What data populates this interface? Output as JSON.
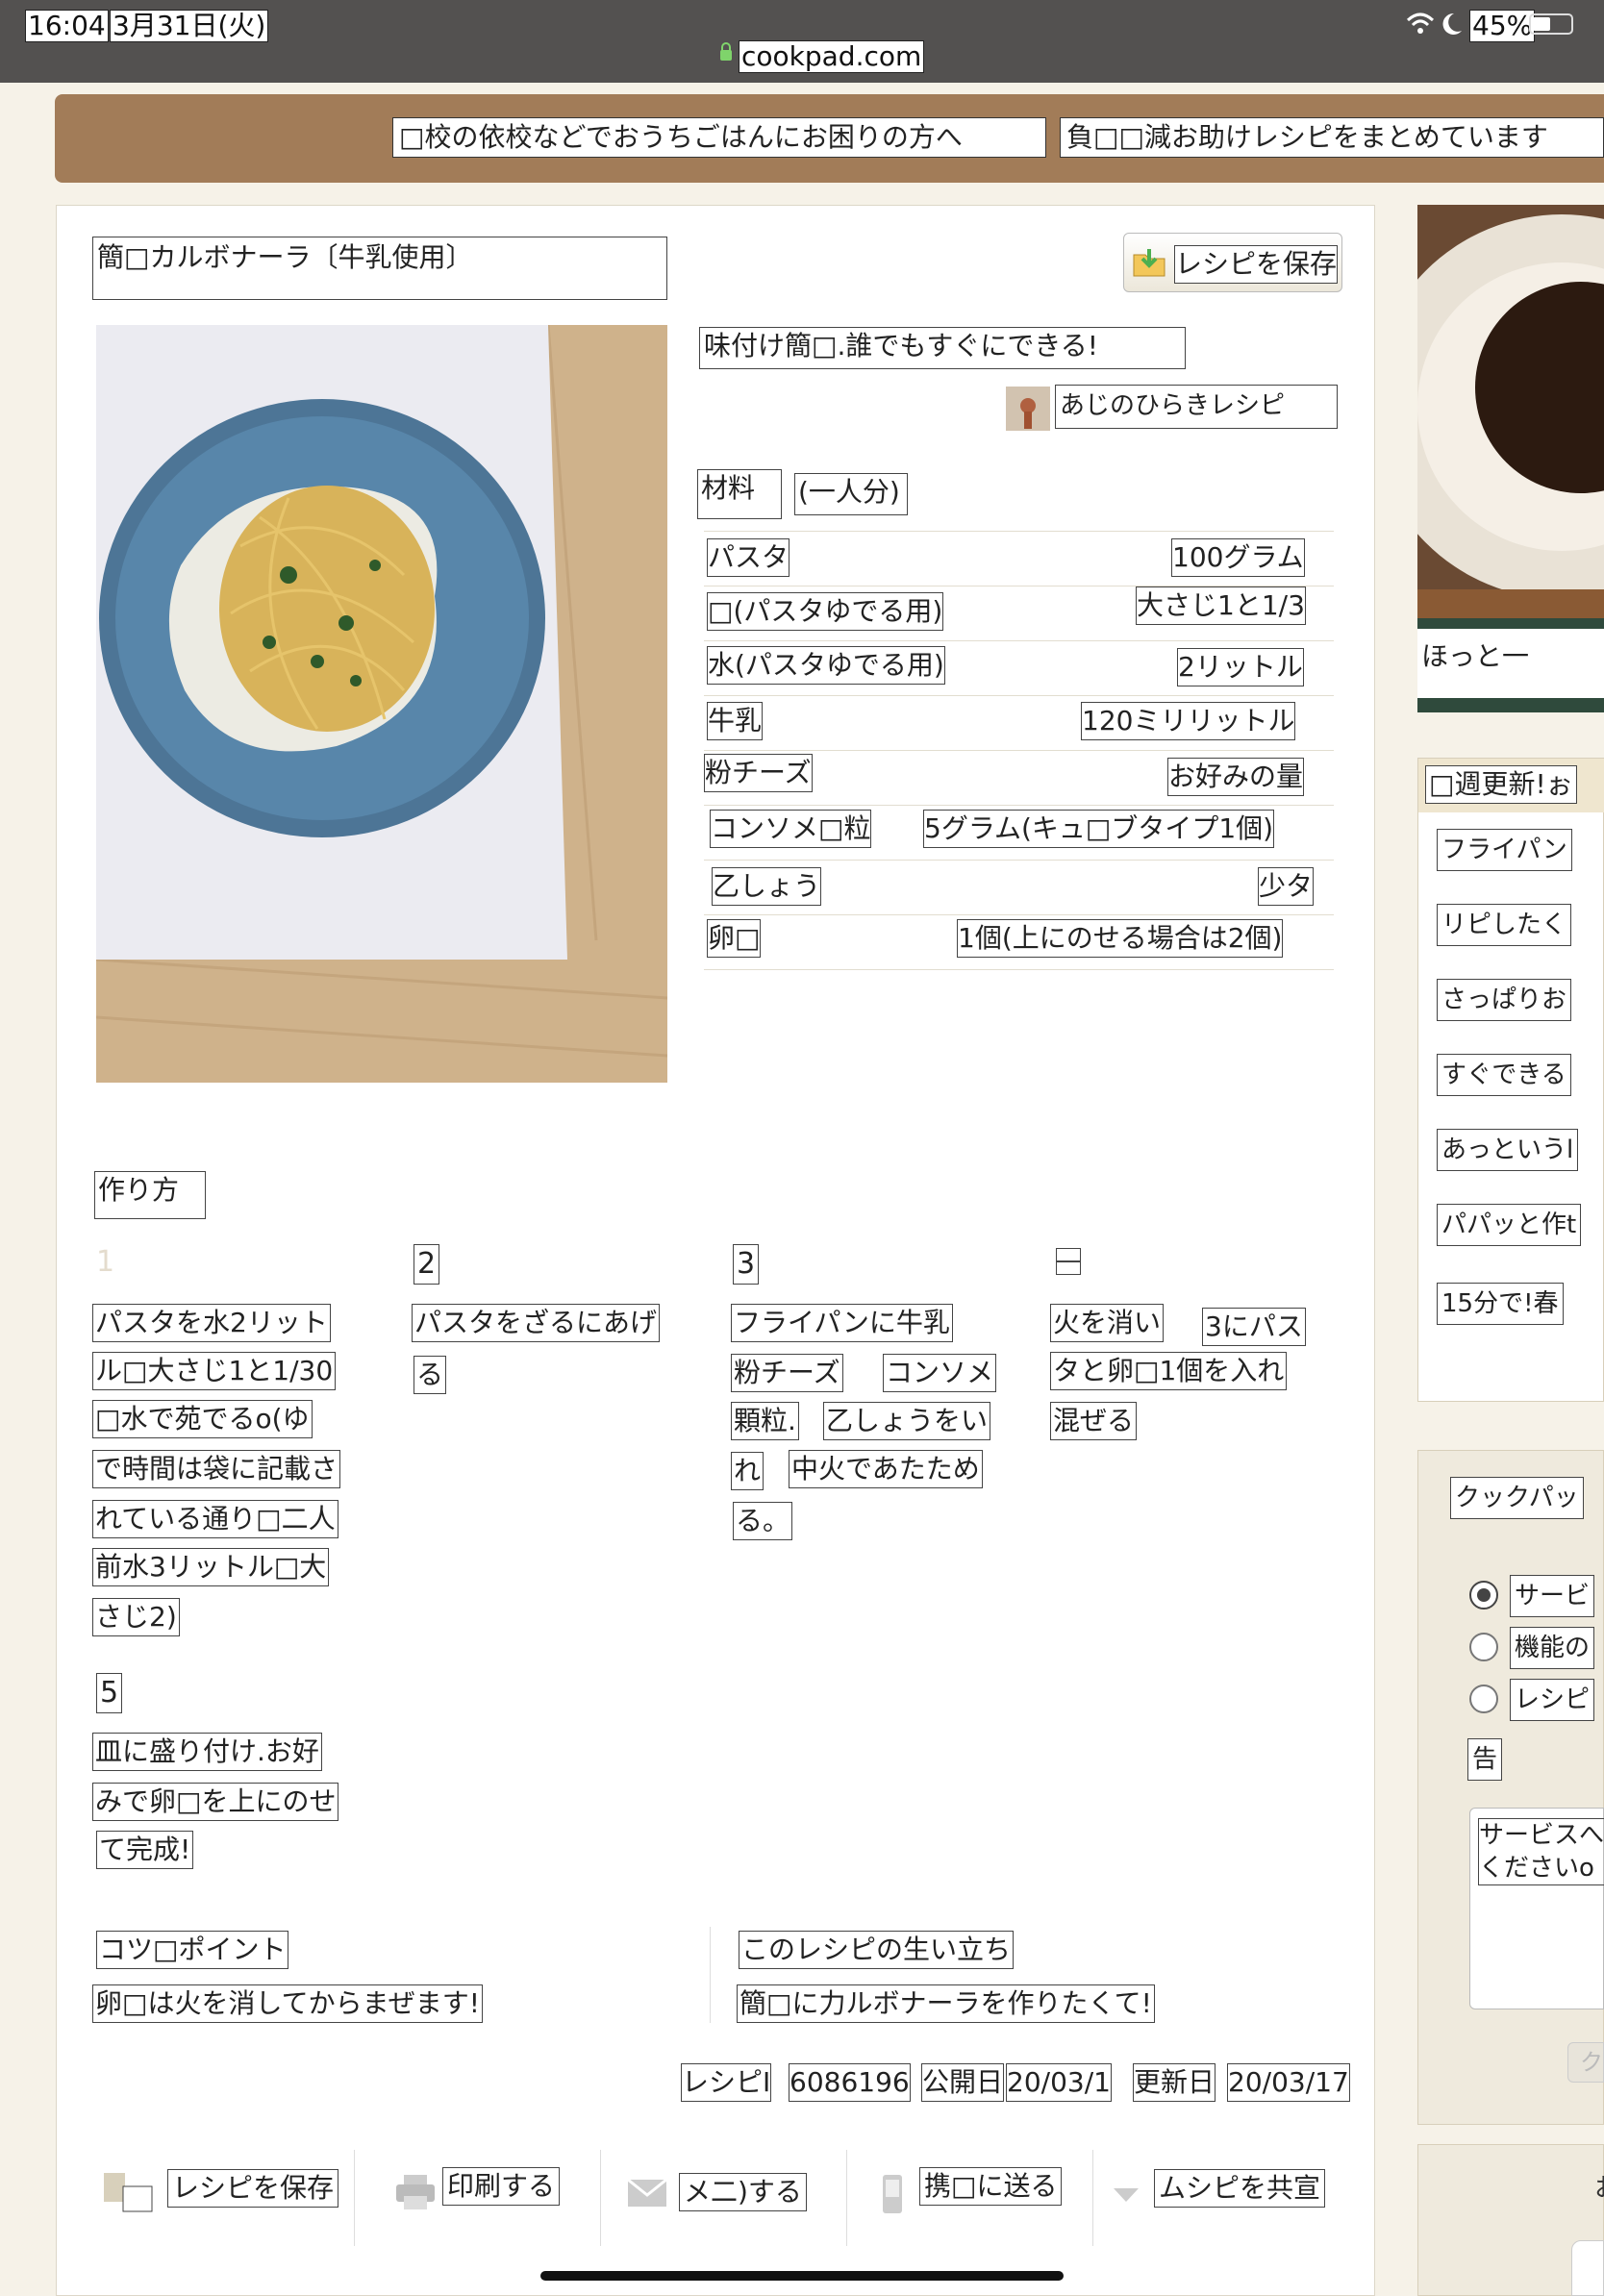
{
  "status_bar": {
    "time": "16:04",
    "date": "3月31日(火)",
    "url": "cookpad.com",
    "battery": "45%"
  },
  "banner": {
    "text1": "□校の依校などでおうちごはんにお困りの方へ",
    "text2": "負□□減お助けレシピをまとめています"
  },
  "recipe": {
    "title": "簡□カルボナーラ〔牛乳使用〕",
    "save_button": "レシピを保存",
    "description": "味付け簡□.誰でもすぐにできる!",
    "author": "あじのひらきレシピ",
    "ingredients_title": "材料",
    "servings": "(一人分)",
    "ingredients": [
      {
        "name": "パスタ",
        "qty": "100グラム"
      },
      {
        "name": "□(パスタゆでる用)",
        "qty": "大さじ1と1/3"
      },
      {
        "name": "水(パスタゆでる用)",
        "qty": "2リットル"
      },
      {
        "name": "牛乳",
        "qty": "120ミリリットル"
      },
      {
        "name": "粉チーズ",
        "qty": "お好みの量"
      },
      {
        "name": "コンソメ□粒",
        "qty": "5グラム(キュ□ブタイプ1個)"
      },
      {
        "name": "乙しょう",
        "qty": "少タ"
      },
      {
        "name": "卵□",
        "qty": "1個(上にのせる場合は2個)"
      }
    ],
    "steps_title": "作り方",
    "steps": [
      {
        "num": "1",
        "lines": [
          "パスタを水2リット",
          "ル□大さじ1と1/30",
          "□水で苑でるo(ゆ",
          "で時間は袋に記載さ",
          "れている通り□二人",
          "前水3リットル□大",
          "さじ2)"
        ]
      },
      {
        "num": "2",
        "lines": [
          "パスタをざるにあげ",
          "る"
        ]
      },
      {
        "num": "3",
        "lines": [
          "フライパンに牛乳",
          "粉チーズ",
          "コンソメ",
          "顆粒.",
          "乙しょうをい",
          "れ",
          "中火であたため",
          "る。"
        ]
      },
      {
        "num": "4",
        "lines": [
          "火を消い",
          "3にパス",
          "タと卵□1個を入れ",
          "混ぜる"
        ]
      },
      {
        "num": "5",
        "lines": [
          "皿に盛り付け.お好",
          "みで卵□を上にのせ",
          "て完成!"
        ]
      }
    ],
    "tips_title": "コツ□ポイント",
    "tips_text": "卵□は火を消してからまぜます!",
    "story_title": "このレシピの生い立ち",
    "story_text": "簡□に力ルボナーラを作りたくて!",
    "meta": {
      "id_label": "レシピI",
      "id_value": "6086196",
      "published_label": "公開日",
      "published_value": "20/03/1",
      "updated_label": "更新日",
      "updated_value": "20/03/17"
    },
    "actions": [
      "レシピを保存",
      "印刷する",
      "メ二)する",
      "携□に送る",
      "ムシピを共宣"
    ]
  },
  "sidebar": {
    "photo_caption": "ほっと一",
    "weekly_title": "□週更新!ぉ",
    "weekly_items": [
      "フライパン",
      "リピしたく",
      "さっぱりお",
      "すぐできる",
      "あっというl",
      "パパッと作t",
      "15分で!春"
    ],
    "form_title": "クックパッ",
    "radio_options": [
      "サービ",
      "機能の",
      "レシピ"
    ],
    "report_label": "告",
    "textarea_text": "サービスへ\nくださいo",
    "submit_label": "ク"
  }
}
